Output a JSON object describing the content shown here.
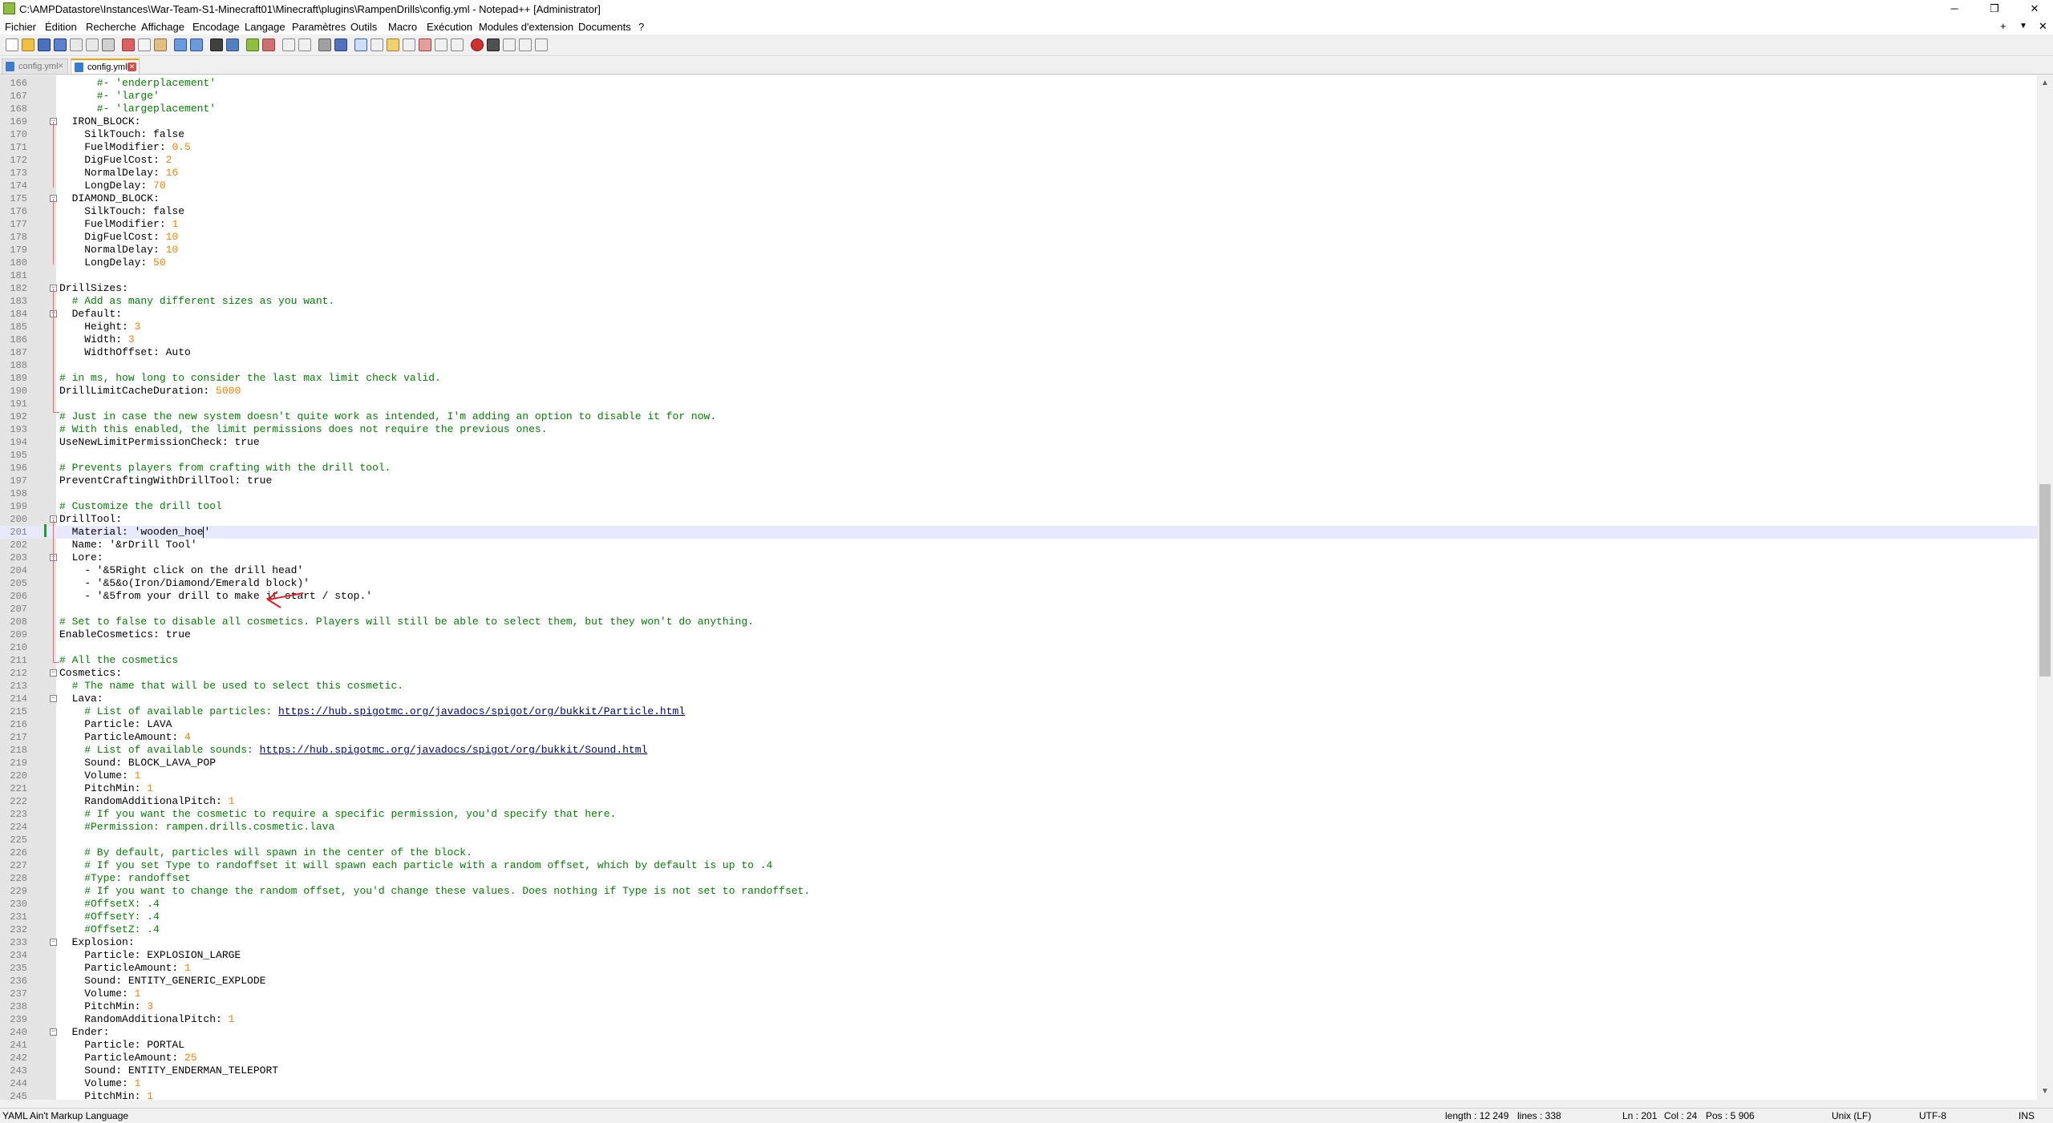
{
  "window": {
    "title": "C:\\AMPDatastore\\Instances\\War-Team-S1-Minecraft01\\Minecraft\\plugins\\RampenDrills\\config.yml - Notepad++ [Administrator]",
    "controls": {
      "minimize": "─",
      "restore": "❐",
      "close": "✕"
    }
  },
  "menu": {
    "items": [
      "Fichier",
      "Édition",
      "Recherche",
      "Affichage",
      "Encodage",
      "Langage",
      "Paramètres",
      "Outils",
      "Macro",
      "Exécution",
      "Modules d'extension",
      "Documents",
      "?"
    ],
    "right": {
      "add": "+",
      "dropdown": "▼",
      "close": "✕"
    }
  },
  "tabs": [
    {
      "label": "config.yml",
      "active": false
    },
    {
      "label": "config.yml",
      "active": true
    }
  ],
  "editor": {
    "current_line": 201,
    "lines": [
      {
        "n": "166",
        "t": [
          {
            "s": "      #- 'enderplacement'",
            "k": "c"
          }
        ]
      },
      {
        "n": "167",
        "t": [
          {
            "s": "      #- 'large'",
            "k": "c"
          }
        ]
      },
      {
        "n": "168",
        "t": [
          {
            "s": "      #- 'largeplacement'",
            "k": "c"
          }
        ]
      },
      {
        "n": "169",
        "f": 1,
        "t": [
          {
            "s": "  IRON_BLOCK:"
          }
        ]
      },
      {
        "n": "170",
        "t": [
          {
            "s": "    SilkTouch: false"
          }
        ]
      },
      {
        "n": "171",
        "t": [
          {
            "s": "    FuelModifier: "
          },
          {
            "s": "0.5",
            "k": "n"
          }
        ]
      },
      {
        "n": "172",
        "t": [
          {
            "s": "    DigFuelCost: "
          },
          {
            "s": "2",
            "k": "n"
          }
        ]
      },
      {
        "n": "173",
        "t": [
          {
            "s": "    NormalDelay: "
          },
          {
            "s": "16",
            "k": "n"
          }
        ]
      },
      {
        "n": "174",
        "t": [
          {
            "s": "    LongDelay: "
          },
          {
            "s": "70",
            "k": "n"
          }
        ]
      },
      {
        "n": "175",
        "f": 1,
        "t": [
          {
            "s": "  DIAMOND_BLOCK:"
          }
        ]
      },
      {
        "n": "176",
        "t": [
          {
            "s": "    SilkTouch: false"
          }
        ]
      },
      {
        "n": "177",
        "t": [
          {
            "s": "    FuelModifier: "
          },
          {
            "s": "1",
            "k": "n"
          }
        ]
      },
      {
        "n": "178",
        "t": [
          {
            "s": "    DigFuelCost: "
          },
          {
            "s": "10",
            "k": "n"
          }
        ]
      },
      {
        "n": "179",
        "t": [
          {
            "s": "    NormalDelay: "
          },
          {
            "s": "10",
            "k": "n"
          }
        ]
      },
      {
        "n": "180",
        "t": [
          {
            "s": "    LongDelay: "
          },
          {
            "s": "50",
            "k": "n"
          }
        ]
      },
      {
        "n": "181",
        "t": []
      },
      {
        "n": "182",
        "f": 1,
        "t": [
          {
            "s": "DrillSizes:"
          }
        ]
      },
      {
        "n": "183",
        "t": [
          {
            "s": "  # Add as many different sizes as you want.",
            "k": "c"
          }
        ]
      },
      {
        "n": "184",
        "f": 1,
        "t": [
          {
            "s": "  Default:"
          }
        ]
      },
      {
        "n": "185",
        "t": [
          {
            "s": "    Height: "
          },
          {
            "s": "3",
            "k": "n"
          }
        ]
      },
      {
        "n": "186",
        "t": [
          {
            "s": "    Width: "
          },
          {
            "s": "3",
            "k": "n"
          }
        ]
      },
      {
        "n": "187",
        "t": [
          {
            "s": "    WidthOffset: Auto"
          }
        ]
      },
      {
        "n": "188",
        "t": []
      },
      {
        "n": "189",
        "t": [
          {
            "s": "# in ms, how long to consider the last max limit check valid.",
            "k": "c"
          }
        ]
      },
      {
        "n": "190",
        "t": [
          {
            "s": "DrillLimitCacheDuration: "
          },
          {
            "s": "5000",
            "k": "n"
          }
        ]
      },
      {
        "n": "191",
        "t": []
      },
      {
        "n": "192",
        "t": [
          {
            "s": "# Just in case the new system doesn't quite work as intended, I'm adding an option to disable it for now.",
            "k": "c"
          }
        ]
      },
      {
        "n": "193",
        "t": [
          {
            "s": "# With this enabled, the limit permissions does not require the previous ones.",
            "k": "c"
          }
        ]
      },
      {
        "n": "194",
        "t": [
          {
            "s": "UseNewLimitPermissionCheck: true"
          }
        ]
      },
      {
        "n": "195",
        "t": []
      },
      {
        "n": "196",
        "t": [
          {
            "s": "# Prevents players from crafting with the drill tool.",
            "k": "c"
          }
        ]
      },
      {
        "n": "197",
        "t": [
          {
            "s": "PreventCraftingWithDrillTool: true"
          }
        ]
      },
      {
        "n": "198",
        "t": []
      },
      {
        "n": "199",
        "t": [
          {
            "s": "# Customize the drill tool",
            "k": "c"
          }
        ]
      },
      {
        "n": "200",
        "f": 1,
        "t": [
          {
            "s": "DrillTool:"
          }
        ]
      },
      {
        "n": "201",
        "t": [
          {
            "s": "  Material: 'wooden_hoe"
          },
          {
            "caret": 1
          },
          {
            "s": "'"
          }
        ]
      },
      {
        "n": "202",
        "t": [
          {
            "s": "  Name: '&rDrill Tool'"
          }
        ]
      },
      {
        "n": "203",
        "f": 1,
        "t": [
          {
            "s": "  Lore:"
          }
        ]
      },
      {
        "n": "204",
        "t": [
          {
            "s": "    - '&5Right click on the drill head'"
          }
        ]
      },
      {
        "n": "205",
        "t": [
          {
            "s": "    - '&5&o(Iron/Diamond/Emerald block)'"
          }
        ]
      },
      {
        "n": "206",
        "t": [
          {
            "s": "    - '&5from your drill to make it start / stop.'"
          }
        ]
      },
      {
        "n": "207",
        "t": []
      },
      {
        "n": "208",
        "t": [
          {
            "s": "# Set to false to disable all cosmetics. Players will still be able to select them, but they won't do anything.",
            "k": "c"
          }
        ]
      },
      {
        "n": "209",
        "t": [
          {
            "s": "EnableCosmetics: true"
          }
        ]
      },
      {
        "n": "210",
        "t": []
      },
      {
        "n": "211",
        "t": [
          {
            "s": "# All the cosmetics",
            "k": "c"
          }
        ]
      },
      {
        "n": "212",
        "f": 1,
        "t": [
          {
            "s": "Cosmetics:"
          }
        ]
      },
      {
        "n": "213",
        "t": [
          {
            "s": "  # The name that will be used to select this cosmetic.",
            "k": "c"
          }
        ]
      },
      {
        "n": "214",
        "f": 1,
        "t": [
          {
            "s": "  Lava:"
          }
        ]
      },
      {
        "n": "215",
        "t": [
          {
            "s": "    # List of available particles: ",
            "k": "c"
          },
          {
            "s": "https://hub.spigotmc.org/javadocs/spigot/org/bukkit/Particle.html",
            "k": "u"
          }
        ]
      },
      {
        "n": "216",
        "t": [
          {
            "s": "    Particle: LAVA"
          }
        ]
      },
      {
        "n": "217",
        "t": [
          {
            "s": "    ParticleAmount: "
          },
          {
            "s": "4",
            "k": "n"
          }
        ]
      },
      {
        "n": "218",
        "t": [
          {
            "s": "    # List of available sounds: ",
            "k": "c"
          },
          {
            "s": "https://hub.spigotmc.org/javadocs/spigot/org/bukkit/Sound.html",
            "k": "u"
          }
        ]
      },
      {
        "n": "219",
        "t": [
          {
            "s": "    Sound: BLOCK_LAVA_POP"
          }
        ]
      },
      {
        "n": "220",
        "t": [
          {
            "s": "    Volume: "
          },
          {
            "s": "1",
            "k": "n"
          }
        ]
      },
      {
        "n": "221",
        "t": [
          {
            "s": "    PitchMin: "
          },
          {
            "s": "1",
            "k": "n"
          }
        ]
      },
      {
        "n": "222",
        "t": [
          {
            "s": "    RandomAdditionalPitch: "
          },
          {
            "s": "1",
            "k": "n"
          }
        ]
      },
      {
        "n": "223",
        "t": [
          {
            "s": "    # If you want the cosmetic to require a specific permission, you'd specify that here.",
            "k": "c"
          }
        ]
      },
      {
        "n": "224",
        "t": [
          {
            "s": "    #Permission: rampen.drills.cosmetic.lava",
            "k": "c"
          }
        ]
      },
      {
        "n": "225",
        "t": []
      },
      {
        "n": "226",
        "t": [
          {
            "s": "    # By default, particles will spawn in the center of the block.",
            "k": "c"
          }
        ]
      },
      {
        "n": "227",
        "t": [
          {
            "s": "    # If you set Type to randoffset it will spawn each particle with a random offset, which by default is up to .4",
            "k": "c"
          }
        ]
      },
      {
        "n": "228",
        "t": [
          {
            "s": "    #Type: randoffset",
            "k": "c"
          }
        ]
      },
      {
        "n": "229",
        "t": [
          {
            "s": "    # If you want to change the random offset, you'd change these values. Does nothing if Type is not set to randoffset.",
            "k": "c"
          }
        ]
      },
      {
        "n": "230",
        "t": [
          {
            "s": "    #OffsetX: .4",
            "k": "c"
          }
        ]
      },
      {
        "n": "231",
        "t": [
          {
            "s": "    #OffsetY: .4",
            "k": "c"
          }
        ]
      },
      {
        "n": "232",
        "t": [
          {
            "s": "    #OffsetZ: .4",
            "k": "c"
          }
        ]
      },
      {
        "n": "233",
        "f": 1,
        "t": [
          {
            "s": "  Explosion:"
          }
        ]
      },
      {
        "n": "234",
        "t": [
          {
            "s": "    Particle: EXPLOSION_LARGE"
          }
        ]
      },
      {
        "n": "235",
        "t": [
          {
            "s": "    ParticleAmount: "
          },
          {
            "s": "1",
            "k": "n"
          }
        ]
      },
      {
        "n": "236",
        "t": [
          {
            "s": "    Sound: ENTITY_GENERIC_EXPLODE"
          }
        ]
      },
      {
        "n": "237",
        "t": [
          {
            "s": "    Volume: "
          },
          {
            "s": "1",
            "k": "n"
          }
        ]
      },
      {
        "n": "238",
        "t": [
          {
            "s": "    PitchMin: "
          },
          {
            "s": "3",
            "k": "n"
          }
        ]
      },
      {
        "n": "239",
        "t": [
          {
            "s": "    RandomAdditionalPitch: "
          },
          {
            "s": "1",
            "k": "n"
          }
        ]
      },
      {
        "n": "240",
        "f": 1,
        "t": [
          {
            "s": "  Ender:"
          }
        ]
      },
      {
        "n": "241",
        "t": [
          {
            "s": "    Particle: PORTAL"
          }
        ]
      },
      {
        "n": "242",
        "t": [
          {
            "s": "    ParticleAmount: "
          },
          {
            "s": "25",
            "k": "n"
          }
        ]
      },
      {
        "n": "243",
        "t": [
          {
            "s": "    Sound: ENTITY_ENDERMAN_TELEPORT"
          }
        ]
      },
      {
        "n": "244",
        "t": [
          {
            "s": "    Volume: "
          },
          {
            "s": "1",
            "k": "n"
          }
        ]
      },
      {
        "n": "245",
        "t": [
          {
            "s": "    PitchMin: "
          },
          {
            "s": "1",
            "k": "n"
          }
        ]
      }
    ]
  },
  "status": {
    "language": "YAML Ain't Markup Language",
    "length": "length : 12 249",
    "lines": "lines : 338",
    "ln": "Ln : 201",
    "col": "Col : 24",
    "pos": "Pos : 5 906",
    "eol": "Unix (LF)",
    "encoding": "UTF-8",
    "mode": "INS"
  },
  "colors": {
    "comment": "#008000",
    "number": "#ff8000",
    "url": "#000080",
    "current_line": "#e8e8ff",
    "annotation": "#e02020"
  }
}
